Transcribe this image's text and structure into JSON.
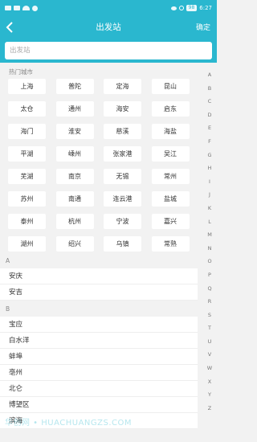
{
  "statusbar": {
    "time": "6:27",
    "battery": "98"
  },
  "nav": {
    "title": "出发站",
    "confirm": "确定",
    "back_icon": "chevron-left"
  },
  "search": {
    "placeholder": "出发站"
  },
  "hot": {
    "title": "热门城市",
    "cities": [
      "上海",
      "普陀",
      "定海",
      "昆山",
      "太仓",
      "通州",
      "海安",
      "启东",
      "海门",
      "淮安",
      "慈溪",
      "海盐",
      "平湖",
      "嵊州",
      "张家港",
      "吴江",
      "芜湖",
      "南京",
      "无锡",
      "常州",
      "苏州",
      "南通",
      "连云港",
      "盐城",
      "泰州",
      "杭州",
      "宁波",
      "嘉兴",
      "湖州",
      "绍兴",
      "乌镇",
      "常熟"
    ]
  },
  "sections": [
    {
      "letter": "A",
      "items": [
        "安庆",
        "安吉"
      ]
    },
    {
      "letter": "B",
      "items": [
        "宝应",
        "白水洋",
        "蚌埠",
        "亳州",
        "北仑",
        "博望区",
        "滨海"
      ]
    }
  ],
  "index_letters": [
    "A",
    "B",
    "C",
    "D",
    "E",
    "F",
    "G",
    "H",
    "I",
    "J",
    "K",
    "L",
    "M",
    "N",
    "O",
    "P",
    "Q",
    "R",
    "S",
    "T",
    "U",
    "V",
    "W",
    "X",
    "Y",
    "Z"
  ],
  "watermark": "华创网 • HUACHUANGZS.COM",
  "colors": {
    "accent": "#2ab7cf"
  }
}
